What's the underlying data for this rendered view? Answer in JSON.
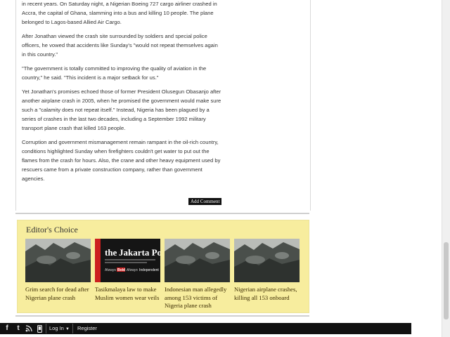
{
  "article": {
    "paragraphs": [
      "in recent years. On Saturday night, a Nigerian Boeing 727 cargo airliner crashed in Accra, the capital of Ghana, slamming into a bus and killing 10 people. The plane belonged to Lagos-based Allied Air Cargo.",
      "After Jonathan viewed the crash site surrounded by soldiers and special police officers, he vowed that accidents like Sunday's \"would not repeat themselves again in this country.\"",
      "\"The government is totally committed to improving the quality of aviation in the country,\" he said. \"This incident is a major setback for us.\"",
      "Yet Jonathan's promises echoed those of former President Olusegun Obasanjo after another airplane crash in 2005, when he promised the government would make sure such a \"calamity does not repeat itself.\" Instead, Nigeria has been plagued by a series of crashes in the last two decades, including a September 1992 military transport plane crash that killed 163 people.",
      "Corruption and government mismanagement remain rampant in the oil-rich country, conditions highlighted Sunday when firefighters couldn't get water to put out the flames from the crash for hours. Also, the crane and other heavy equipment used by rescuers came from a private construction company, rather than government agencies."
    ],
    "add_comment_label": "Add Comment"
  },
  "editors_choice": {
    "title": "Editor's Choice",
    "items": [
      {
        "title": "Grim search for dead after Nigerian plane crash",
        "thumb": "crash-photo"
      },
      {
        "title": "Tasikmalaya law to make Muslim women wear veils",
        "thumb": "jakarta-post-logo",
        "logo_name": "the Jakarta Post",
        "logo_small": "The Journal of Indonesia Today",
        "logo_tag_1": "Always ",
        "logo_tag_bold": "Bold",
        "logo_tag_2": " Always ",
        "logo_tag_3": "Independent"
      },
      {
        "title": "Indonesian man allegedly among 153 victims of Nigeria plane crash",
        "thumb": "crash-photo"
      },
      {
        "title": "Nigerian airplane crashes, killing all 153 onboard",
        "thumb": "crash-photo"
      }
    ]
  },
  "bottombar": {
    "icons": [
      "facebook-icon",
      "twitter-icon",
      "rss-icon",
      "mobile-icon"
    ],
    "login_label": "Log In",
    "register_label": "Register"
  },
  "colors": {
    "editors_bg": "#f7ed9e",
    "bottombar_bg": "#111111",
    "jakarta_red": "#cc1f1f"
  }
}
